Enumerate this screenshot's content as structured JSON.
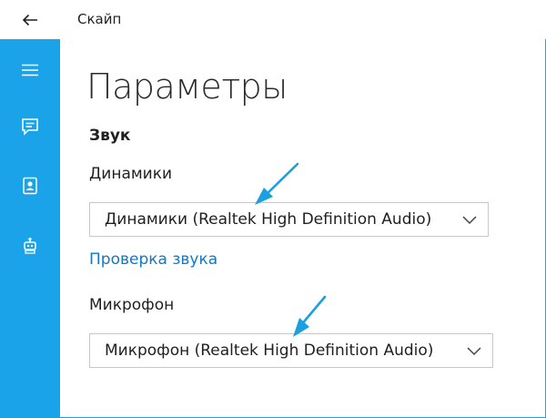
{
  "app": {
    "title": "Скайп"
  },
  "titlebar": {
    "back_icon": "back-arrow-icon"
  },
  "sidebar": {
    "items": [
      {
        "icon": "hamburger-menu-icon"
      },
      {
        "icon": "chat-icon"
      },
      {
        "icon": "contacts-icon"
      },
      {
        "icon": "bot-icon"
      }
    ]
  },
  "page": {
    "title": "Параметры",
    "section": "Звук",
    "speakers": {
      "label": "Динамики",
      "value": "Динамики (Realtek High Definition Audio)"
    },
    "sound_check_link": "Проверка звука",
    "microphone": {
      "label": "Микрофон",
      "value": "Микрофон (Realtek High Definition Audio)"
    }
  },
  "colors": {
    "accent": "#1aa3e8",
    "link": "#1477c4",
    "annotation_arrow": "#1a9fe0"
  }
}
